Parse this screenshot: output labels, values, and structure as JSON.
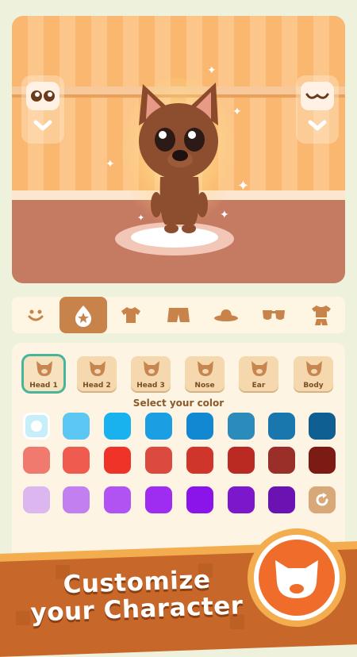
{
  "tabs": [
    {
      "icon": "smile-face-icon",
      "active": false
    },
    {
      "icon": "water-drop-icon",
      "active": true
    },
    {
      "icon": "tshirt-icon",
      "active": false
    },
    {
      "icon": "shorts-icon",
      "active": false
    },
    {
      "icon": "hat-icon",
      "active": false
    },
    {
      "icon": "sunglasses-icon",
      "active": false
    },
    {
      "icon": "outfit-icon",
      "active": false
    }
  ],
  "parts": [
    {
      "label": "Head 1",
      "selected": true
    },
    {
      "label": "Head 2",
      "selected": false
    },
    {
      "label": "Head 3",
      "selected": false
    },
    {
      "label": "Nose",
      "selected": false
    },
    {
      "label": "Ear",
      "selected": false
    },
    {
      "label": "Body",
      "selected": false
    }
  ],
  "color_section": {
    "title": "Select your color"
  },
  "colors": [
    [
      "#c8eef9",
      "#5cc7f2",
      "#19b2ee",
      "#1c9ee2",
      "#1388d2",
      "#2b8cbc",
      "#1a77ad",
      "#0f5f93"
    ],
    [
      "#f07a6e",
      "#ef5b4f",
      "#ee3428",
      "#dc4a3f",
      "#d0352b",
      "#bb2a22",
      "#9a2e28",
      "#7c1a14"
    ],
    [
      "#dcb6ef",
      "#c27ff0",
      "#b153f3",
      "#9e2df1",
      "#8b14ea",
      "#7d17cc",
      "#6a12b2",
      "reset"
    ]
  ],
  "selected_color": "#c8eef9",
  "banner": {
    "line1": "Customize",
    "line2": "your Character"
  },
  "accent": {
    "teal": "#48b59a",
    "tab_active": "#c8834a",
    "banner": "#c8672a"
  }
}
